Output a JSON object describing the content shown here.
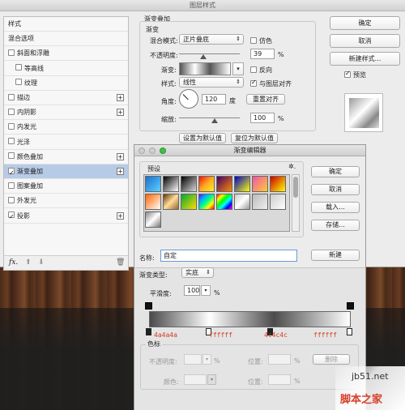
{
  "layer_style": {
    "title": "图层样式",
    "sidebar": [
      {
        "label": "样式",
        "checkbox": false,
        "plus": false,
        "selected": false
      },
      {
        "label": "混合选项",
        "checkbox": false,
        "plus": false,
        "selected": false
      },
      {
        "label": "斜面和浮雕",
        "checkbox": true,
        "checked": false,
        "plus": false,
        "selected": false
      },
      {
        "label": "等高线",
        "checkbox": true,
        "checked": false,
        "plus": false,
        "selected": false,
        "indent": true
      },
      {
        "label": "纹理",
        "checkbox": true,
        "checked": false,
        "plus": false,
        "selected": false,
        "indent": true
      },
      {
        "label": "描边",
        "checkbox": true,
        "checked": false,
        "plus": true,
        "selected": false
      },
      {
        "label": "内阴影",
        "checkbox": true,
        "checked": false,
        "plus": true,
        "selected": false
      },
      {
        "label": "内发光",
        "checkbox": true,
        "checked": false,
        "plus": false,
        "selected": false
      },
      {
        "label": "光泽",
        "checkbox": true,
        "checked": false,
        "plus": false,
        "selected": false
      },
      {
        "label": "颜色叠加",
        "checkbox": true,
        "checked": false,
        "plus": true,
        "selected": false
      },
      {
        "label": "渐变叠加",
        "checkbox": true,
        "checked": true,
        "plus": true,
        "selected": true
      },
      {
        "label": "图案叠加",
        "checkbox": true,
        "checked": false,
        "plus": false,
        "selected": false
      },
      {
        "label": "外发光",
        "checkbox": true,
        "checked": false,
        "plus": false,
        "selected": false
      },
      {
        "label": "投影",
        "checkbox": true,
        "checked": true,
        "plus": true,
        "selected": false
      }
    ],
    "footer_fx": "fx.",
    "section_title": "渐变叠加",
    "sub_title": "渐变",
    "blend_mode_label": "混合模式:",
    "blend_mode_value": "正片叠底",
    "dither_label": "仿色",
    "opacity_label": "不透明度:",
    "opacity_value": "39",
    "opacity_unit": "%",
    "gradient_label": "渐变:",
    "reverse_label": "反向",
    "style_label": "样式:",
    "style_value": "线性",
    "align_label": "与图层对齐",
    "angle_label": "角度:",
    "angle_value": "120",
    "angle_unit": "度",
    "reset_align": "重置对齐",
    "scale_label": "缩放:",
    "scale_value": "100",
    "scale_unit": "%",
    "set_default": "设置为默认值",
    "reset_default": "复位为默认值",
    "ok": "确定",
    "cancel": "取消",
    "new_style": "新建样式...",
    "preview_label": "预览"
  },
  "gradient_editor": {
    "title": "渐变编辑器",
    "presets_label": "预设",
    "gear": "✲.",
    "ok": "确定",
    "cancel": "取消",
    "load": "载入...",
    "save": "存储...",
    "name_label": "名称:",
    "name_value": "自定",
    "new_button": "新建",
    "type_label": "渐变类型:",
    "type_value": "实底",
    "smooth_label": "平滑度:",
    "smooth_value": "100",
    "smooth_unit": "%",
    "stop_colors": [
      "4a4a4a",
      "ffffff",
      "4c4c4c",
      "ffffff"
    ],
    "stops_group": "色标",
    "stop_opacity_label": "不透明度:",
    "stop_location_label": "位置:",
    "stop_unit": "%",
    "delete_button": "删除",
    "color_label": "颜色:"
  },
  "watermark": {
    "site": "jb51.net",
    "brand": "脚本之家"
  }
}
